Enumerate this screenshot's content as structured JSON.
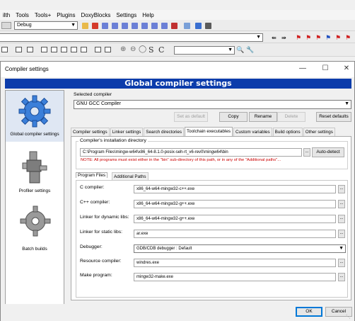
{
  "ide": {
    "menu": [
      "ilth",
      "Tools",
      "Tools+",
      "Plugins",
      "DoxyBlocks",
      "Settings",
      "Help"
    ],
    "build_target": "Debug"
  },
  "dialog": {
    "title": "Compiler settings",
    "heading": "Global compiler settings",
    "sidebar": [
      {
        "label": "Global compiler settings",
        "icon": "gear-icon",
        "selected": true
      },
      {
        "label": "Profiler settings",
        "icon": "profiler-icon",
        "selected": false
      },
      {
        "label": "Batch builds",
        "icon": "batch-gear-icon",
        "selected": false
      }
    ],
    "selected_compiler_label": "Selected compiler",
    "selected_compiler": "GNU GCC Compiler",
    "buttons": {
      "set_default": "Set as default",
      "copy": "Copy",
      "rename": "Rename",
      "delete": "Delete",
      "reset_defaults": "Reset defaults"
    },
    "tabs": [
      "Compiler settings",
      "Linker settings",
      "Search directories",
      "Toolchain executables",
      "Custom variables",
      "Build options",
      "Other settings"
    ],
    "active_tab": "Toolchain executables",
    "install_dir": {
      "group_label": "Compiler's installation directory",
      "value": "C:\\Program Files\\mingw-w64\\x86_64-8.1.0-posix-seh-rt_v6-rev0\\mingw64\\bin",
      "browse": "...",
      "auto_detect": "Auto-detect",
      "note": "NOTE: All programs must exist either in the \"bin\" sub-directory of this path, or in any of the \"Additional paths\"..."
    },
    "subtabs": [
      "Program Files",
      "Additional Paths"
    ],
    "programs": [
      {
        "label": "C compiler:",
        "value": "x86_64-w64-mingw32-c++.exe"
      },
      {
        "label": "C++ compiler:",
        "value": "x86_64-w64-mingw32-g++.exe"
      },
      {
        "label": "Linker for dynamic libs:",
        "value": "x86_64-w64-mingw32-g++.exe"
      },
      {
        "label": "Linker for static libs:",
        "value": "ar.exe"
      }
    ],
    "debugger": {
      "label": "Debugger:",
      "value": "GDB/CDB debugger : Default"
    },
    "programs2": [
      {
        "label": "Resource compiler:",
        "value": "windres.exe"
      },
      {
        "label": "Make program:",
        "value": "mingw32-make.exe"
      }
    ],
    "ok": "OK",
    "cancel": "Cancel"
  },
  "colors": {
    "banner": "#0c3cab",
    "note": "#cc0000"
  }
}
